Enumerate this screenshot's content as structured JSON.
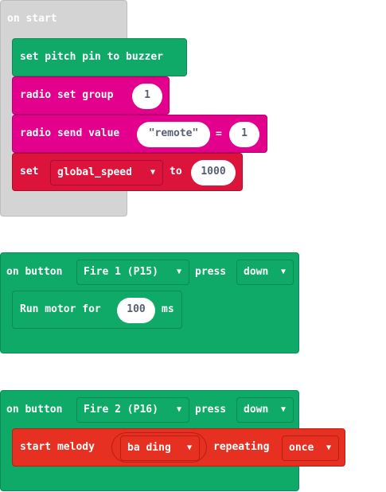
{
  "on_start": {
    "hat": "on start",
    "pitch": "set pitch pin to buzzer",
    "radio_group": {
      "label": "radio set group",
      "value": "1"
    },
    "radio_send": {
      "label": "radio send value",
      "key": "remote",
      "equals": "=",
      "value": "1"
    },
    "set_var": {
      "label": "set",
      "variable": "global_speed",
      "to": "to",
      "value": "1000"
    }
  },
  "fire1": {
    "prefix": "on button",
    "button": "Fire 1 (P15)",
    "press": "press",
    "action": "down",
    "motor": {
      "label": "Run motor for",
      "value": "100",
      "unit": "ms"
    }
  },
  "fire2": {
    "prefix": "on button",
    "button": "Fire 2 (P16)",
    "press": "press",
    "action": "down",
    "melody": {
      "label": "start melody",
      "tune": "ba ding",
      "repeating": "repeating",
      "mode": "once"
    }
  },
  "icons": {
    "dropdown": "triangle-down-icon"
  },
  "colors": {
    "events": "#0fa968",
    "events_dark": "#0b8a55",
    "music": "#e63022",
    "music_dark": "#b81e12",
    "radio": "#e3008c",
    "radio_dark": "#b5006f",
    "variables": "#dc143c",
    "variables_dark": "#a80e2d",
    "start_bg": "#d4d4d4",
    "start_border": "#bdbdbd"
  }
}
